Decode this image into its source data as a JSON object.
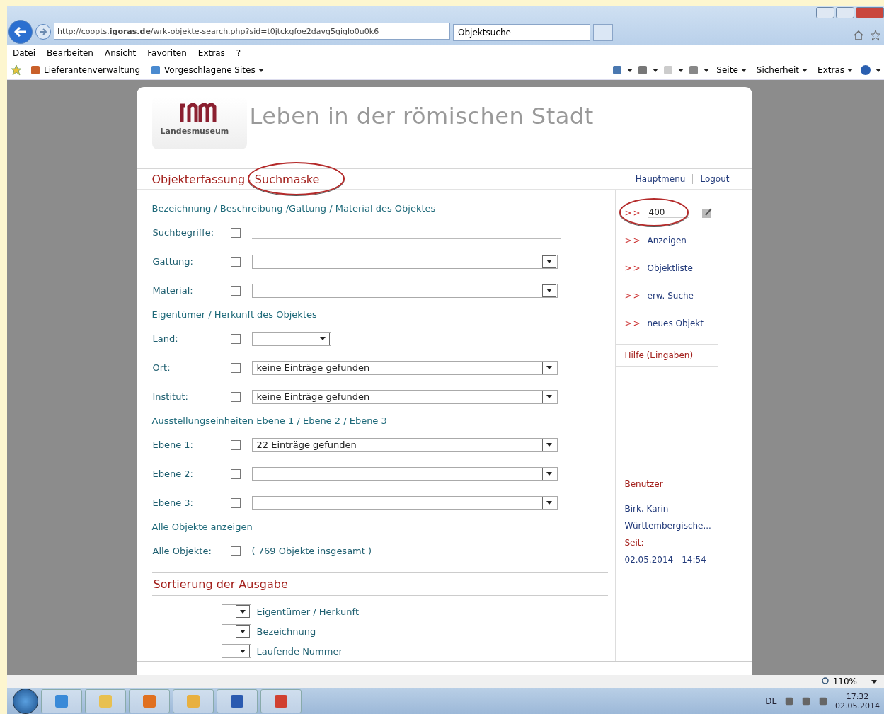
{
  "browser": {
    "url": "http://coopts.**igoras.de**/wrk-objekte-search.php?sid=t0jtckgfoe2davg5giglo0u0k6",
    "tabs": [
      {
        "title": "Objektsuche",
        "selected": true
      }
    ],
    "menu": [
      "Datei",
      "Bearbeiten",
      "Ansicht",
      "Favoriten",
      "Extras",
      "?"
    ],
    "favorites": [
      "Lieferantenverwaltung",
      "Vorgeschlagene Sites"
    ],
    "commands": [
      "Seite",
      "Sicherheit",
      "Extras"
    ]
  },
  "page": {
    "title": "Leben in der römischen Stadt",
    "logo_text": "Landesmuseum",
    "breadcrumb": [
      {
        "label": "Objekterfassung",
        "circled": false
      },
      {
        "label": "Suchmaske",
        "circled": true
      }
    ],
    "breadcrumb_separator": "-",
    "nav_links": [
      "Hauptmenu",
      "Logout"
    ],
    "sections": [
      {
        "heading": "Bezeichnung / Beschreibung /Gattung / Material des Objektes",
        "fields": [
          {
            "label": "Suchbegriffe:",
            "kind": "text",
            "checked": false
          },
          {
            "label": "Gattung:",
            "kind": "select",
            "checked": false
          },
          {
            "label": "Material:",
            "kind": "select",
            "checked": false
          }
        ]
      },
      {
        "heading": "Eigentümer / Herkunft des Objektes",
        "fields": [
          {
            "label": "Land:",
            "kind": "short",
            "checked": false
          },
          {
            "label": "Ort:",
            "kind": "select",
            "checked": false,
            "value": "keine Einträge gefunden"
          },
          {
            "label": "Institut:",
            "kind": "select",
            "checked": false,
            "value": "keine Einträge gefunden"
          }
        ]
      },
      {
        "heading": "Ausstellungseinheiten Ebene 1 / Ebene 2 / Ebene 3",
        "fields": [
          {
            "label": "Ebene 1:",
            "kind": "select",
            "checked": false,
            "value": "22 Einträge gefunden"
          },
          {
            "label": "Ebene 2:",
            "kind": "select",
            "checked": false
          },
          {
            "label": "Ebene 3:",
            "kind": "select",
            "checked": false
          }
        ]
      },
      {
        "heading": "Alle Objekte anzeigen",
        "fields": [
          {
            "label": "Alle Objekte:",
            "kind": "note",
            "checked": false,
            "value": "( 769 Objekte insgesamt )"
          }
        ]
      }
    ],
    "sort": {
      "heading": "Sortierung der Ausgabe",
      "items": [
        "Eigentümer / Herkunft",
        "Bezeichnung",
        "Laufende Nummer"
      ]
    },
    "sidebar": {
      "number_field": {
        "marker": ">>",
        "value": "400",
        "circled": true
      },
      "links": [
        {
          "marker": ">>",
          "label": "Anzeigen"
        },
        {
          "marker": ">>",
          "label": "Objektliste"
        },
        {
          "marker": ">>",
          "label": "erw. Suche"
        },
        {
          "marker": ">>",
          "label": "neues Objekt"
        }
      ],
      "help": "Hilfe (Eingaben)",
      "user": {
        "heading": "Benutzer",
        "name": "Birk, Karin",
        "org": "Württembergische...",
        "since_label": "Seit:",
        "since": "02.05.2014 - 14:54"
      }
    }
  },
  "status_bar": {
    "zoom": "110%"
  },
  "taskbar": {
    "language": "DE",
    "time": "17:32",
    "date": "02.05.2014"
  }
}
